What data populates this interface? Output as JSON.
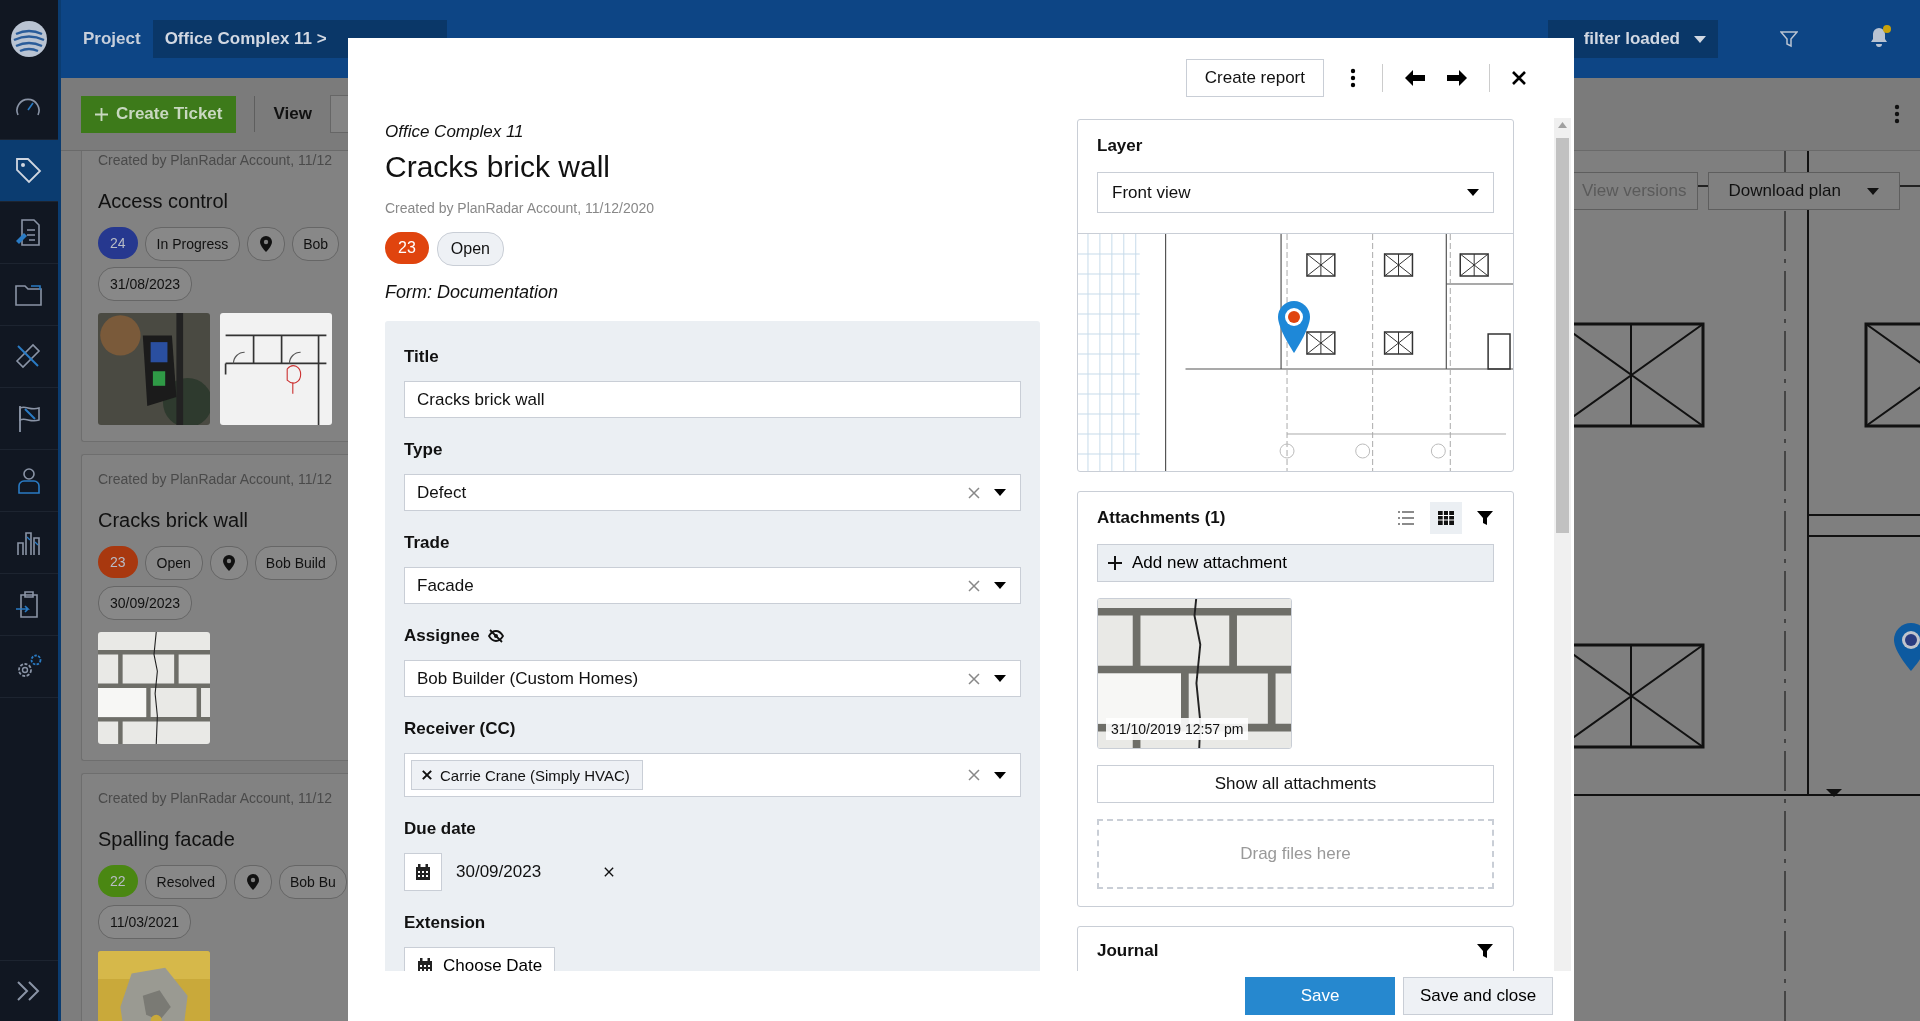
{
  "top_bar": {
    "project_label": "Project",
    "project": "Office Complex 11 >",
    "filter": "filter loaded"
  },
  "sidebar": {
    "items": [
      {
        "selected": false
      },
      {
        "selected": true
      },
      {
        "selected": false
      },
      {
        "selected": false
      },
      {
        "selected": false
      },
      {
        "selected": false
      },
      {
        "selected": false
      },
      {
        "selected": false
      },
      {
        "selected": false
      },
      {
        "selected": false
      }
    ]
  },
  "toolbar": {
    "create_button": "Create Ticket",
    "view_label": "View"
  },
  "tickets": [
    {
      "created": "Created by PlanRadar Account, 11/12",
      "title": "Access control",
      "number": "24",
      "color": "#26388f",
      "status": "In Progress",
      "assignee": "Bob",
      "date": "31/08/2023",
      "pictures": [
        {
          "kind": "device"
        },
        {
          "kind": "floorplan"
        }
      ]
    },
    {
      "created": "Created by PlanRadar Account, 11/12",
      "title": "Cracks brick wall",
      "number": "23",
      "color": "#a8380f",
      "status": "Open",
      "assignee": "Bob Build",
      "date": "30/09/2023",
      "pictures": [
        {
          "kind": "bricks"
        }
      ]
    },
    {
      "created": "Created by PlanRadar Account, 11/12",
      "title": "Spalling facade",
      "number": "22",
      "color": "#4a8712",
      "status": "Resolved",
      "assignee": "Bob Bu",
      "date": "11/03/2021",
      "pictures": [
        {
          "kind": "spalling"
        }
      ]
    }
  ],
  "plan": {
    "buttons": [
      "View versions",
      "Download plan"
    ]
  },
  "modal": {
    "report_button": "Create report",
    "project": "Office Complex 11",
    "title": "Cracks brick wall",
    "created": "Created by PlanRadar Account, 11/12/2020",
    "number": "23",
    "color": "#e0440e",
    "status": "Open",
    "form": "Form: Documentation",
    "fields": [
      {
        "kind": "text",
        "label": "Title",
        "value": "Cracks brick wall"
      },
      {
        "kind": "select",
        "label": "Type",
        "value": "Defect"
      },
      {
        "kind": "select",
        "label": "Trade",
        "value": "Facade"
      },
      {
        "kind": "select",
        "label": "Assignee",
        "private": true,
        "value": "Bob Builder (Custom Homes)"
      },
      {
        "kind": "multiselect",
        "label": "Receiver (CC)",
        "values": [
          "Carrie Crane (Simply HVAC)"
        ]
      },
      {
        "kind": "date",
        "label": "Due date",
        "value": "30/09/2023"
      },
      {
        "kind": "date",
        "label": "Extension",
        "placeholder": "Choose Date"
      }
    ],
    "layer": {
      "title": "Layer",
      "value": "Front view"
    },
    "attachments": {
      "title": "Attachments (1)",
      "views": [
        {
          "selected": false
        },
        {
          "selected": true
        }
      ],
      "add_button": "Add new attachment",
      "items": [
        {
          "kind": "picture",
          "timestamp": "31/10/2019 12:57 pm"
        }
      ],
      "show_all_button": "Show all attachments",
      "drop_zone": "Drag files here"
    },
    "journal": {
      "title": "Journal"
    },
    "save_button": "Save",
    "save_close_button": "Save and close"
  }
}
